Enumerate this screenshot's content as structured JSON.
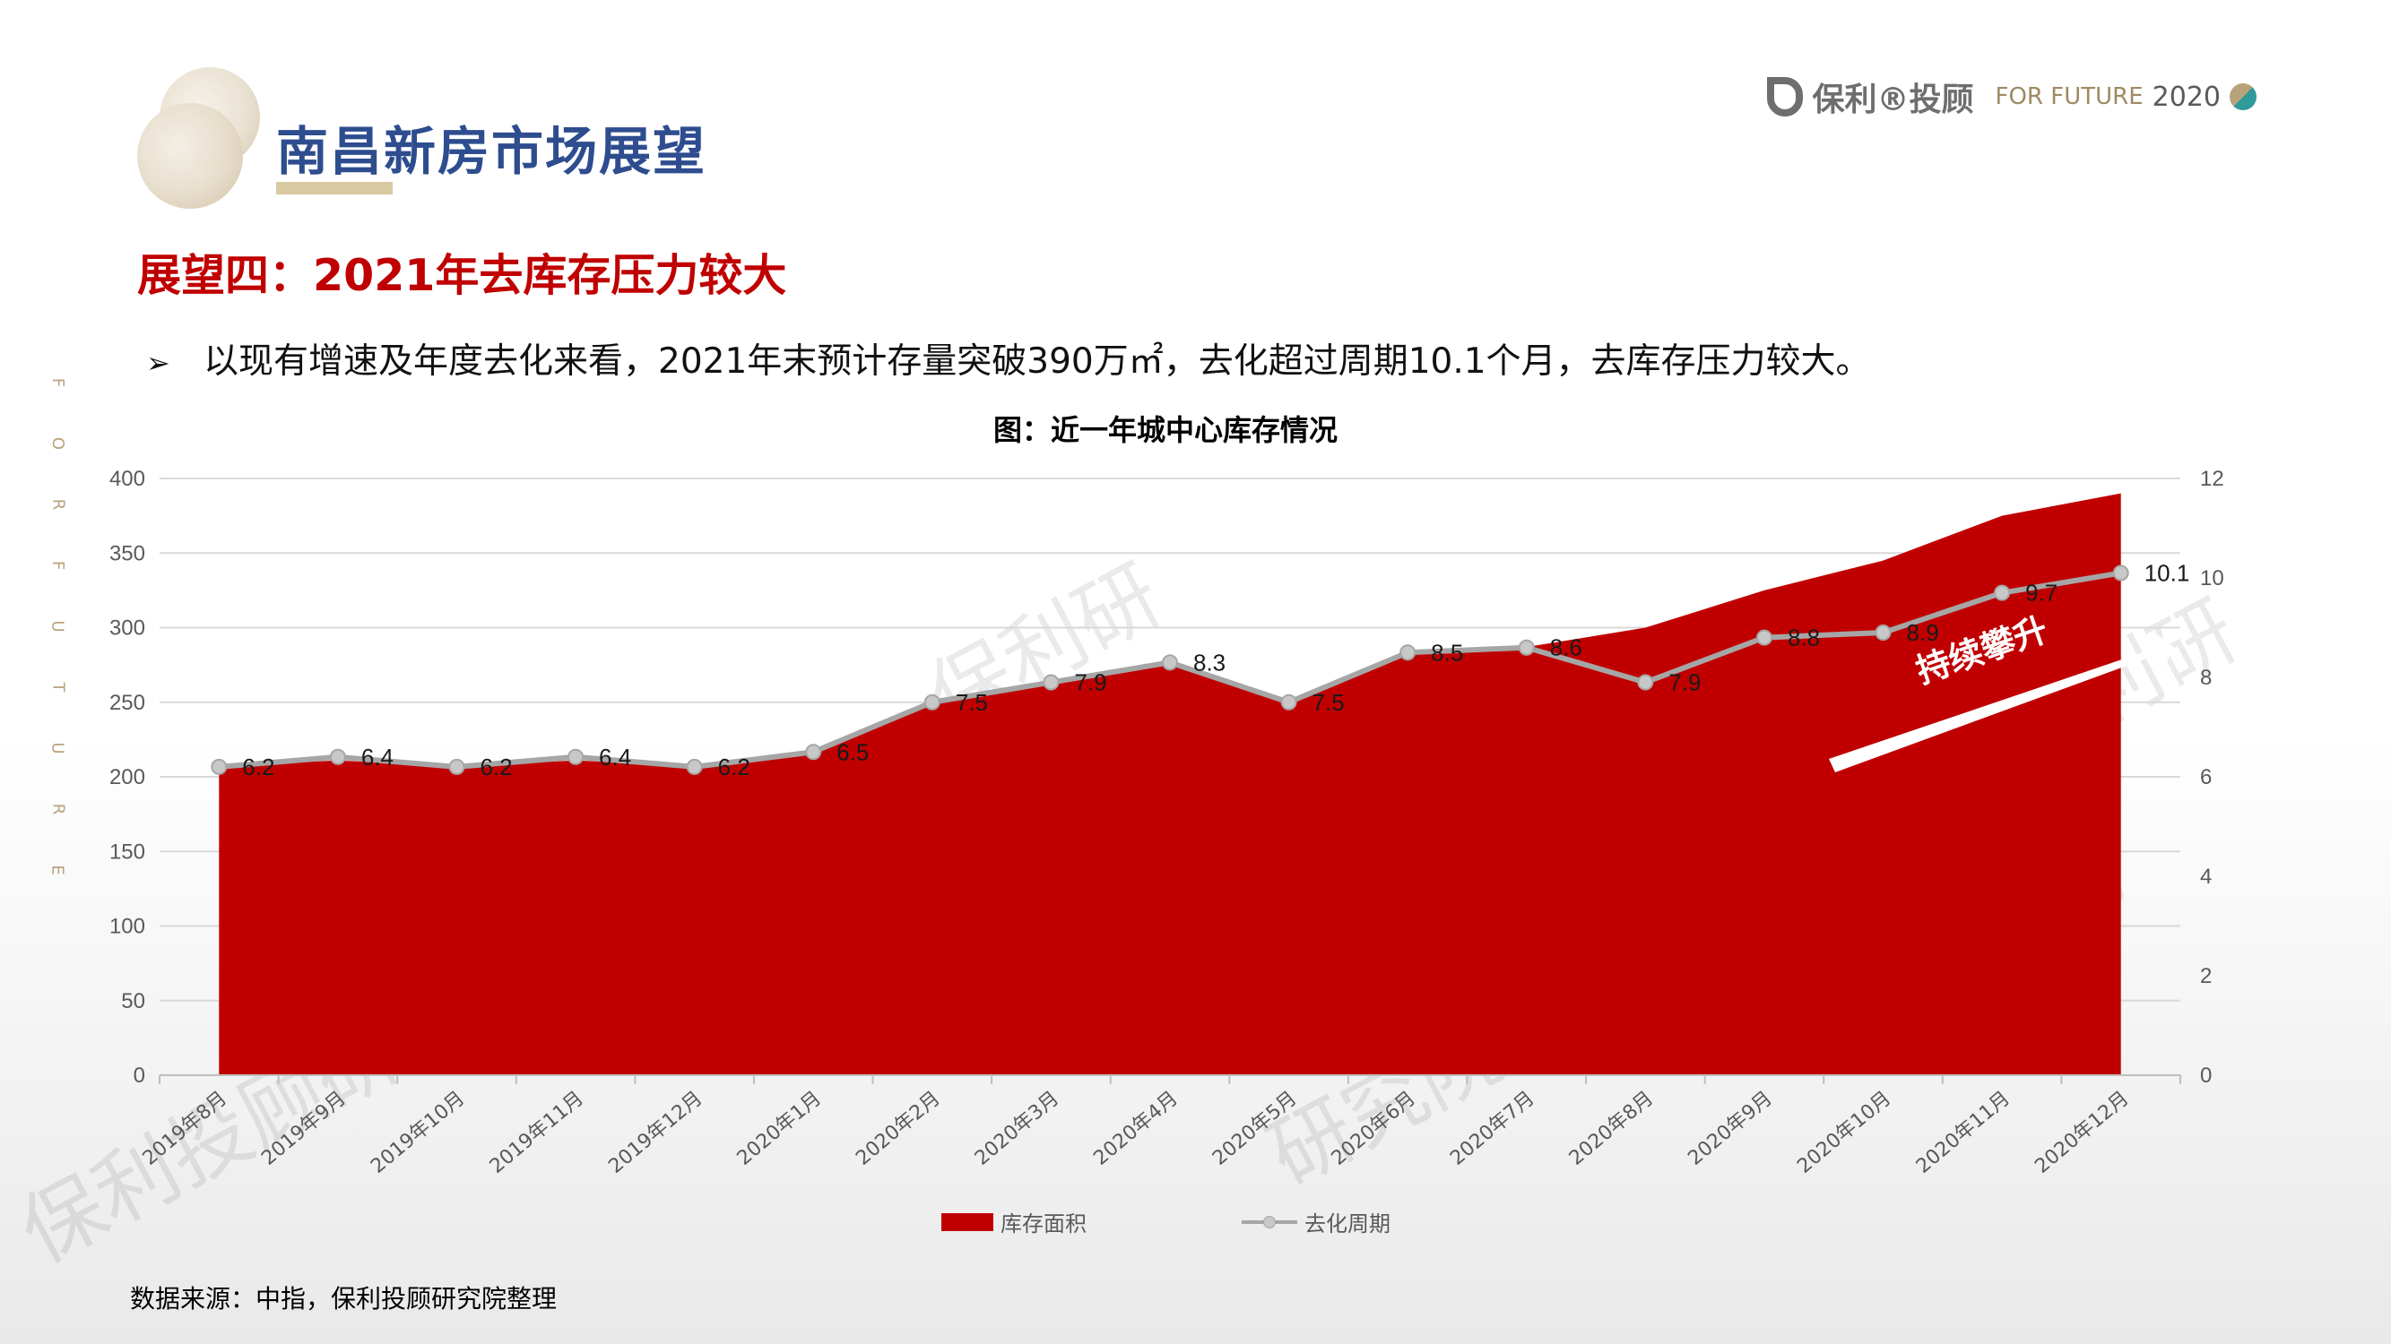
{
  "header": {
    "title": "南昌新房市场展望",
    "logo_text": "保利®投顾",
    "logo_slogan": "FOR FUTURE",
    "logo_year": "2020"
  },
  "side_letters": [
    "F",
    "O",
    "R",
    "F",
    "U",
    "T",
    "U",
    "R",
    "E"
  ],
  "subtitle": "展望四：2021年去库存压力较大",
  "bullet": {
    "mark": "➢",
    "text": "以现有增速及年度去化来看，2021年末预计存量突破390万㎡，去化超过周期10.1个月，去库存压力较大。"
  },
  "chart_title": "图：近一年城中心库存情况",
  "chart_data": {
    "type": "area+line",
    "categories": [
      "2019年8月",
      "2019年9月",
      "2019年10月",
      "2019年11月",
      "2019年12月",
      "2020年1月",
      "2020年2月",
      "2020年3月",
      "2020年4月",
      "2020年5月",
      "2020年6月",
      "2020年7月",
      "2020年8月",
      "2020年9月",
      "2020年10月",
      "2020年11月",
      "2020年12月"
    ],
    "series": [
      {
        "name": "库存面积",
        "type": "area",
        "axis": "left",
        "color": "#c00000",
        "values": [
          207,
          211,
          207,
          211,
          207,
          215,
          250,
          262,
          275,
          250,
          283,
          287,
          300,
          325,
          345,
          375,
          390
        ]
      },
      {
        "name": "去化周期",
        "type": "line",
        "axis": "right",
        "color": "#a6a6a6",
        "values": [
          6.2,
          6.4,
          6.2,
          6.4,
          6.2,
          6.5,
          7.5,
          7.9,
          8.3,
          7.5,
          8.5,
          8.6,
          7.9,
          8.8,
          8.9,
          9.7,
          10.1
        ]
      }
    ],
    "left_axis": {
      "min": 0,
      "max": 400,
      "ticks": [
        0,
        50,
        100,
        150,
        200,
        250,
        300,
        350,
        400
      ]
    },
    "right_axis": {
      "min": 0,
      "max": 12,
      "ticks": [
        0,
        2,
        4,
        6,
        8,
        10,
        12
      ]
    },
    "grid": true,
    "legend_position": "bottom",
    "annotation": "持续攀升",
    "watermarks": [
      "保利投顾研究院",
      "保利研",
      "研究院",
      "保利研",
      "研究院"
    ]
  },
  "source": "数据来源：中指，保利投顾研究院整理"
}
